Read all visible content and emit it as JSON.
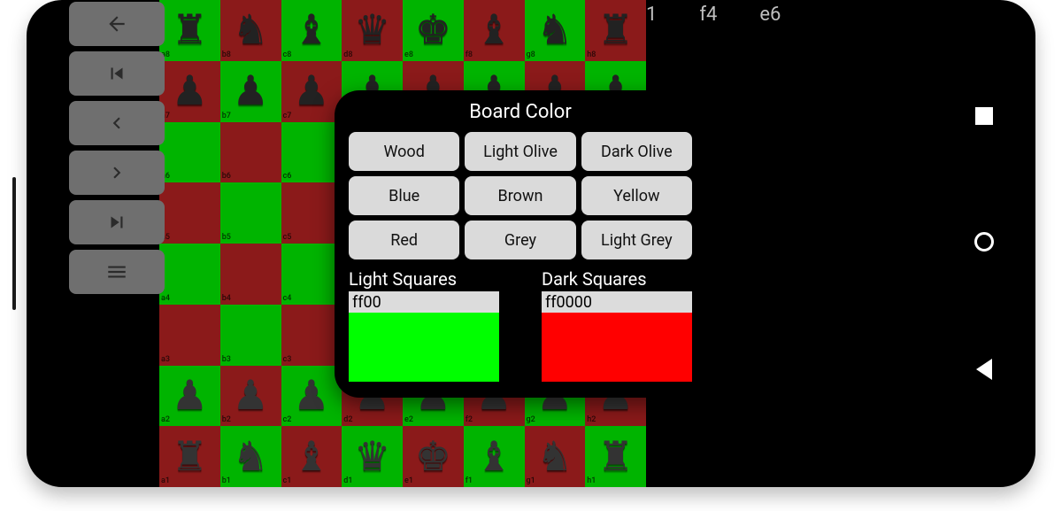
{
  "status": {
    "a": "1",
    "b": "f4",
    "c": "e6"
  },
  "nav": {
    "back": "back",
    "first": "first",
    "prev": "prev",
    "next": "next",
    "last": "last",
    "menu": "menu"
  },
  "board": {
    "light_color": "#00b400",
    "dark_color": "#8b1a1a",
    "files": [
      "a",
      "b",
      "c",
      "d",
      "e",
      "f",
      "g",
      "h"
    ],
    "ranks": [
      "8",
      "7",
      "6",
      "5",
      "4",
      "3",
      "2",
      "1"
    ],
    "pieces": {
      "a8": "r",
      "b8": "n",
      "c8": "b",
      "d8": "q",
      "e8": "k",
      "f8": "b",
      "g8": "n",
      "h8": "r",
      "a7": "p",
      "b7": "p",
      "c7": "p",
      "d7": "p",
      "e7": "p",
      "f7": "p",
      "g7": "p",
      "h7": "p",
      "a2": "P",
      "b2": "P",
      "c2": "P",
      "d2": "P",
      "e2": "P",
      "f2": "P",
      "g2": "P",
      "h2": "P",
      "a1": "R",
      "b1": "N",
      "c1": "B",
      "d1": "Q",
      "e1": "K",
      "f1": "B",
      "g1": "N",
      "h1": "R"
    }
  },
  "dialog": {
    "title": "Board Color",
    "presets": [
      "Wood",
      "Light Olive",
      "Dark Olive",
      "Blue",
      "Brown",
      "Yellow",
      "Red",
      "Grey",
      "Light Grey"
    ],
    "light_label": "Light Squares",
    "dark_label": "Dark Squares",
    "light_value": "ff00",
    "dark_value": "ff0000",
    "light_preview": "#00ff00",
    "dark_preview": "#ff0000"
  }
}
